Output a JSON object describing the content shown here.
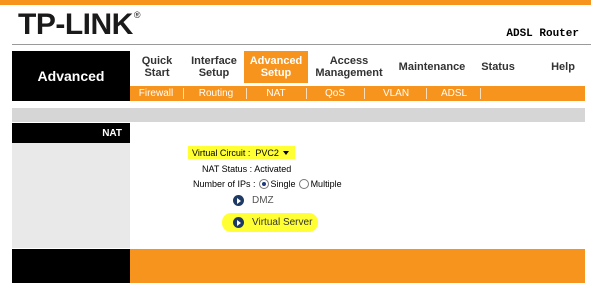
{
  "brand": {
    "logo": "TP-LINK",
    "registered_mark": "®",
    "model": "ADSL Router"
  },
  "section_title": "Advanced",
  "main_nav": [
    {
      "label": "Quick\nStart"
    },
    {
      "label": "Interface\nSetup"
    },
    {
      "label": "Advanced\nSetup",
      "active": true
    },
    {
      "label": "Access\nManagement"
    },
    {
      "label": "Maintenance"
    },
    {
      "label": "Status"
    },
    {
      "label": "Help"
    }
  ],
  "sub_nav": [
    "Firewall",
    "Routing",
    "NAT",
    "QoS",
    "VLAN",
    "ADSL"
  ],
  "page": {
    "side_label": "NAT",
    "virtual_circuit": {
      "label": "Virtual Circuit :",
      "value": "PVC2"
    },
    "nat_status": {
      "label": "NAT Status :",
      "value": "Activated"
    },
    "number_of_ips": {
      "label": "Number of IPs :",
      "options": [
        "Single",
        "Multiple"
      ],
      "selected": "Single"
    },
    "links": {
      "dmz": "DMZ",
      "virtual_server": "Virtual Server"
    }
  },
  "colors": {
    "accent": "#f7941d",
    "highlight": "#ffff33",
    "bullet": "#1e3a64"
  }
}
